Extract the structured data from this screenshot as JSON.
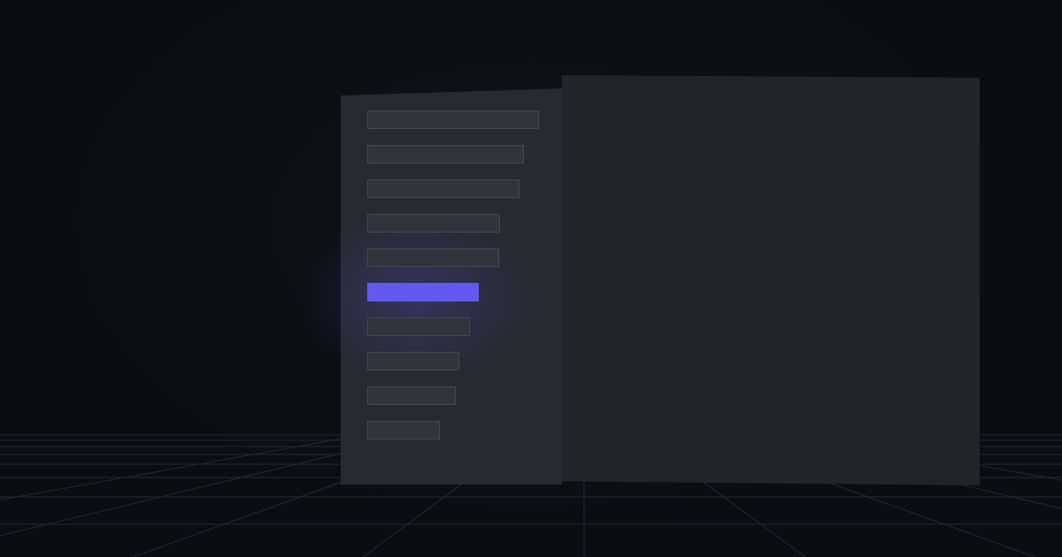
{
  "menu": {
    "items": [
      {
        "id": "item-1",
        "active": false
      },
      {
        "id": "item-2",
        "active": false
      },
      {
        "id": "item-3",
        "active": false
      },
      {
        "id": "item-4",
        "active": false
      },
      {
        "id": "item-5",
        "active": false
      },
      {
        "id": "item-6",
        "active": true
      },
      {
        "id": "item-7",
        "active": false
      },
      {
        "id": "item-8",
        "active": false
      },
      {
        "id": "item-9",
        "active": false
      },
      {
        "id": "item-10",
        "active": false
      }
    ],
    "accent_color": "#6259f0"
  }
}
